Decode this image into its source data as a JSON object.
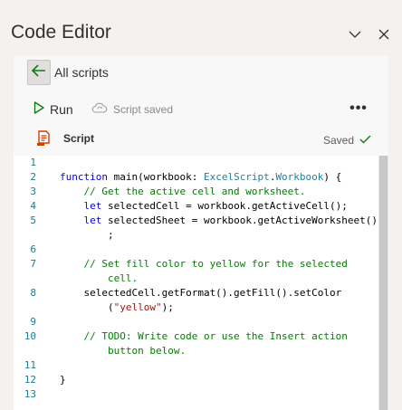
{
  "pane": {
    "title": "Code Editor",
    "collapse_icon": "chevron-down-icon",
    "close_icon": "close-icon"
  },
  "nav": {
    "back_icon": "arrow-left-icon",
    "all_scripts_label": "All scripts"
  },
  "toolbar": {
    "run_label": "Run",
    "run_icon": "play-icon",
    "save_status_label": "Script saved",
    "save_status_icon": "cloud-sync-icon",
    "more_icon": "more-icon",
    "more_label": "•••"
  },
  "file": {
    "icon": "script-file-icon",
    "name": "Script",
    "state_label": "Saved",
    "state_icon": "checkmark-icon"
  },
  "editor": {
    "line_numbers": [
      "1",
      "2",
      "3",
      "4",
      "5",
      "6",
      "7",
      "8",
      "9",
      "10",
      "11",
      "12",
      "13"
    ],
    "code_lines": [
      "",
      "function main(workbook: ExcelScript.Workbook) {",
      "    // Get the active cell and worksheet.",
      "    let selectedCell = workbook.getActiveCell();",
      "    let selectedSheet = workbook.getActiveWorksheet()",
      "        ;",
      "",
      "    // Set fill color to yellow for the selected",
      "        cell.",
      "    selectedCell.getFormat().getFill().setColor",
      "        (\"yellow\");",
      "",
      "    // TODO: Write code or use the Insert action",
      "        button below.",
      "",
      "}",
      ""
    ]
  },
  "colors": {
    "pane_background": "#f3f2f1",
    "editor_background": "#ffffff",
    "keyword": "#0000ff",
    "type": "#267f99",
    "comment": "#008000",
    "string": "#a31515",
    "line_number": "#237893",
    "success": "#107c10",
    "script_icon": "#d83b01"
  }
}
